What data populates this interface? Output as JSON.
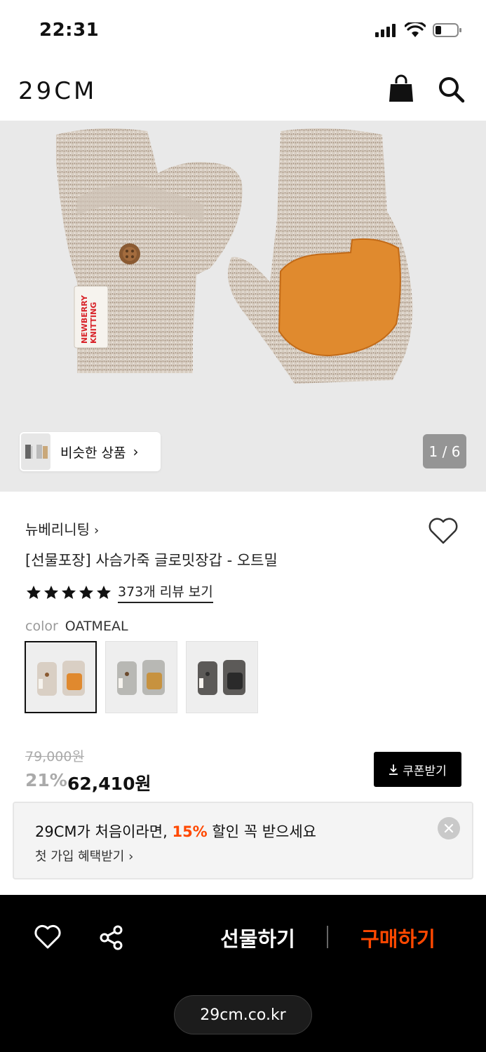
{
  "status": {
    "time": "22:31"
  },
  "header": {
    "logo": "29CM"
  },
  "gallery": {
    "similar_label": "비슷한 상품",
    "page_indicator": "1 / 6",
    "product_tag_text": "NEWBERRY KNITTING"
  },
  "product": {
    "brand": "뉴베리니팅",
    "name": "[선물포장] 사슴가죽 글로밋장갑 - 오트밀",
    "rating": 5,
    "review_link": "373개 리뷰 보기",
    "color_label": "color",
    "color_value": "OATMEAL",
    "swatches": [
      {
        "name": "oatmeal",
        "selected": true,
        "knit": "#d9cfc4",
        "patch": "#e0892e"
      },
      {
        "name": "grey",
        "selected": false,
        "knit": "#b8b8b4",
        "patch": "#c7923f"
      },
      {
        "name": "charcoal",
        "selected": false,
        "knit": "#5c5a58",
        "patch": "#2a2a2a"
      }
    ]
  },
  "price": {
    "original": "79,000원",
    "discount": "21%",
    "final": "62,410원",
    "coupon_label": "쿠폰받기"
  },
  "promo": {
    "title_prefix": "29CM가 처음이라면, ",
    "title_highlight": "15%",
    "title_suffix": " 할인 꼭 받으세요",
    "subtitle": "첫 가입 혜택받기 ›"
  },
  "bottom_bar": {
    "gift_label": "선물하기",
    "buy_label": "구매하기",
    "url": "29cm.co.kr"
  },
  "colors": {
    "accent": "#ff4800",
    "gallery_bg": "#e9e9e9",
    "bottom_bg": "#000000"
  }
}
